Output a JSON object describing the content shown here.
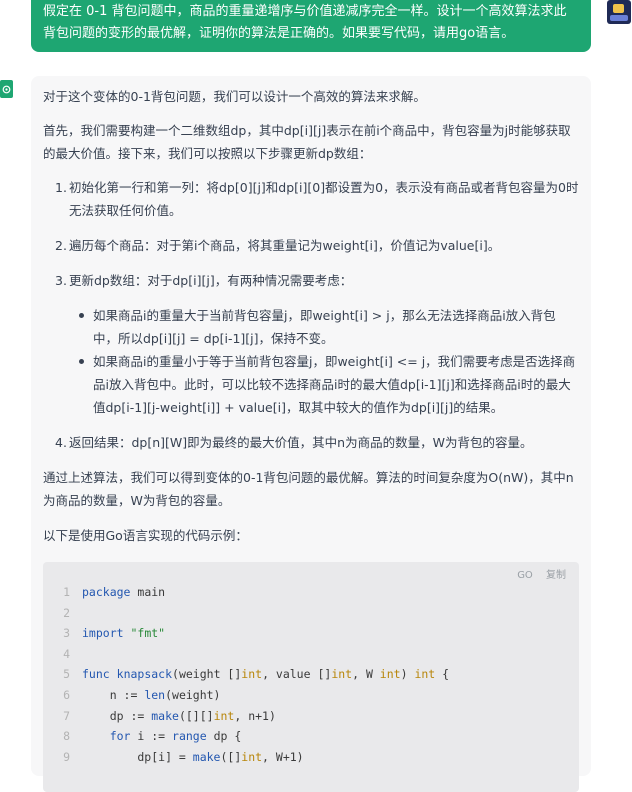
{
  "user_message": {
    "text": "假定在 0-1 背包问题中，商品的重量递增序与价值递减序完全一样。设计一个高效算法求此背包问题的变形的最优解，证明你的算法是正确的。如果要写代码，请用go语言。"
  },
  "answer": {
    "intro": "对于这个变体的0-1背包问题，我们可以设计一个高效的算法来求解。",
    "setup": "首先，我们需要构建一个二维数组dp，其中dp[i][j]表示在前i个商品中，背包容量为j时能够获取的最大价值。接下来，我们可以按照以下步骤更新dp数组：",
    "steps": [
      {
        "num": "1.",
        "text": "初始化第一行和第一列：将dp[0][j]和dp[i][0]都设置为0，表示没有商品或者背包容量为0时无法获取任何价值。"
      },
      {
        "num": "2.",
        "text": "遍历每个商品：对于第i个商品，将其重量记为weight[i]，价值记为value[i]。"
      },
      {
        "num": "3.",
        "text": "更新dp数组：对于dp[i][j]，有两种情况需要考虑："
      },
      {
        "num": "4.",
        "text": "返回结果：dp[n][W]即为最终的最大价值，其中n为商品的数量，W为背包的容量。"
      }
    ],
    "sub_bullets": [
      "如果商品i的重量大于当前背包容量j，即weight[i] > j，那么无法选择商品i放入背包中，所以dp[i][j] = dp[i-1][j]，保持不变。",
      "如果商品i的重量小于等于当前背包容量j，即weight[i] <= j，我们需要考虑是否选择商品i放入背包中。此时，可以比较不选择商品i时的最大值dp[i-1][j]和选择商品i时的最大值dp[i-1][j-weight[i]] + value[i]，取其中较大的值作为dp[i][j]的结果。"
    ],
    "conclusion": "通过上述算法，我们可以得到变体的0-1背包问题的最优解。算法的时间复杂度为O(nW)，其中n为商品的数量，W为背包的容量。",
    "code_intro": "以下是使用Go语言实现的代码示例："
  },
  "code_block": {
    "language": "GO",
    "copy_label": "复制",
    "line_numbers": [
      "1",
      "2",
      "3",
      "4",
      "5",
      "6",
      "7",
      "8",
      "9"
    ],
    "lines": [
      "package main",
      "",
      "import \"fmt\"",
      "",
      "func knapsack(weight []int, value []int, W int) int {",
      "    n := len(weight)",
      "    dp := make([][]int, n+1)",
      "    for i := range dp {",
      "        dp[i] = make([]int, W+1)"
    ]
  },
  "colors": {
    "accent": "#1ea672",
    "card": "#f7f7f8",
    "code_bg": "#e9e9eb"
  },
  "icons": {
    "bot_avatar": "chatgpt-logo-icon",
    "user_avatar": "user-avatar-icon"
  }
}
